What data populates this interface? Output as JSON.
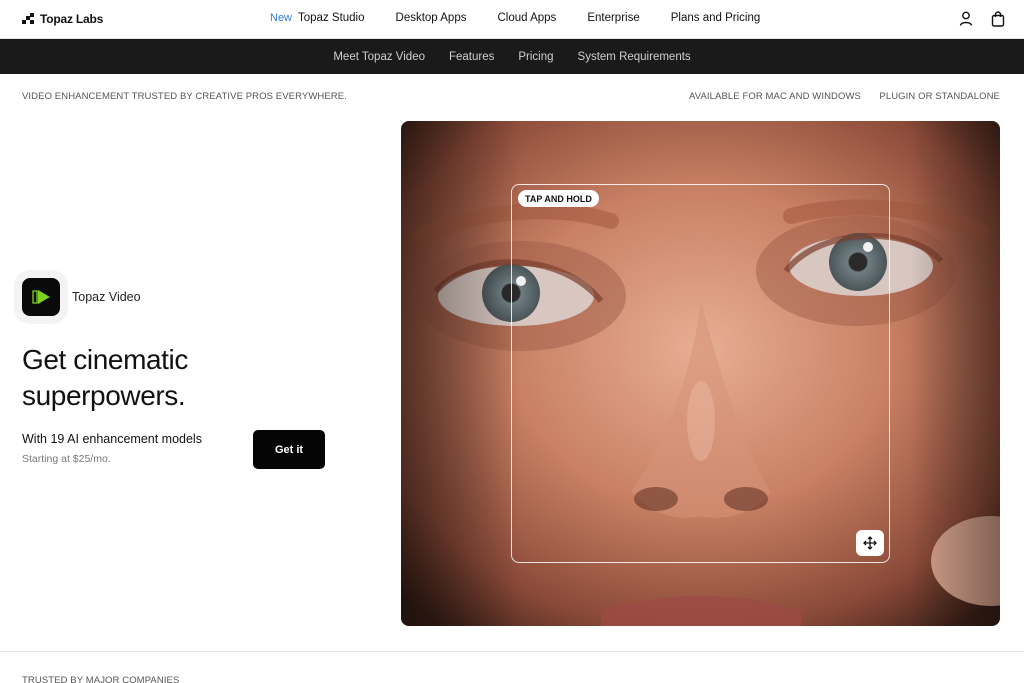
{
  "brand": {
    "name": "Topaz Labs"
  },
  "nav": {
    "new_tag": "New",
    "items": [
      "Topaz Studio",
      "Desktop Apps",
      "Cloud Apps",
      "Enterprise",
      "Plans and Pricing"
    ]
  },
  "subnav": {
    "items": [
      "Meet Topaz Video",
      "Features",
      "Pricing",
      "System Requirements"
    ]
  },
  "infobar": {
    "left": "VIDEO ENHANCEMENT TRUSTED BY CREATIVE PROS EVERYWHERE.",
    "right1": "AVAILABLE FOR MAC AND WINDOWS",
    "right2": "PLUGIN OR STANDALONE"
  },
  "hero": {
    "product_name": "Topaz Video",
    "headline": "Get cinematic superpowers.",
    "tagline": "With 19 AI enhancement models",
    "price_note": "Starting at $25/mo.",
    "cta": "Get it",
    "compare_badge": "TAP AND HOLD"
  },
  "footer": {
    "trusted": "TRUSTED BY MAJOR COMPANIES"
  },
  "colors": {
    "accent_new": "#2f7de1",
    "subnav_bg": "#1a1a1a",
    "product_green": "#7ed321"
  },
  "icons": {
    "account": "user-icon",
    "cart": "bag-icon",
    "move": "move-arrows-icon",
    "logo": "topaz-logo-icon"
  }
}
